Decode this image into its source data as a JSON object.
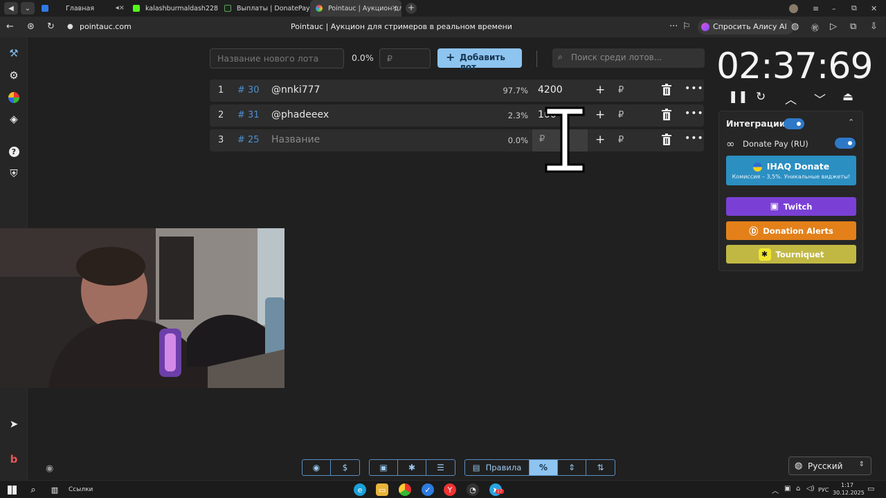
{
  "browser": {
    "tabs": [
      {
        "label": "Главная",
        "muted": true
      },
      {
        "label": "kalashburmaldash228 Str",
        "muted": false
      },
      {
        "label": "Выплаты | DonatePay",
        "muted": false
      },
      {
        "label": "Pointauc | Аукцион для",
        "muted": false,
        "active": true
      }
    ],
    "url": "pointauc.com",
    "page_title": "Pointauc | Аукцион для стримеров в реальном времени",
    "alice_label": "Спросить Алису AI",
    "colors": {
      "tab_bg": "#1f1f1f",
      "toolbar_bg": "#2b2b2b"
    }
  },
  "toolbar": {
    "lot_name_placeholder": "Название нового лота",
    "percent": "0.0%",
    "amount_placeholder": "₽",
    "add_label": "Добавить лот",
    "search_placeholder": "Поиск среди лотов..."
  },
  "lots": [
    {
      "rank": "1",
      "id": "# 30",
      "name": "@nnki777",
      "percent": "97.7%",
      "amount": "4200",
      "placeholder": false
    },
    {
      "rank": "2",
      "id": "# 31",
      "name": "@phadeeex",
      "percent": "2.3%",
      "amount": "100",
      "placeholder": false
    },
    {
      "rank": "3",
      "id": "# 25",
      "name": "Название",
      "percent": "0.0%",
      "amount": "₽",
      "placeholder": true
    }
  ],
  "lot_currency": "₽",
  "timer": {
    "display": "02:37:69",
    "controls": [
      "pause-icon",
      "restart-icon",
      "chevron-up-icon",
      "chevron-down-icon",
      "eject-icon"
    ]
  },
  "integrations": {
    "title": "Интеграции",
    "enabled": true,
    "donatepay_label": "Donate Pay (RU)",
    "donatepay_enabled": true,
    "ihaq_title": "IHAQ Donate",
    "ihaq_sub": "Комиссия – 3,5%. Уникальные виджеты!",
    "twitch": "Twitch",
    "alerts": "Donation Alerts",
    "tourniquet": "Tourniquet",
    "colors": {
      "ihaq": "#2b8fc2",
      "twitch": "#7a40d6",
      "alerts": "#e3801a",
      "tourniquet": "#c1b844"
    }
  },
  "bottombar": {
    "rules": "Правила",
    "percent_symbol": "%",
    "accent": "#8ec4f0"
  },
  "language": {
    "selected": "Русский"
  },
  "taskbar": {
    "links": "Ссылки",
    "lang": "РУС",
    "time": "1:17",
    "date": "30.12.2025",
    "telegram_badge": "17"
  }
}
